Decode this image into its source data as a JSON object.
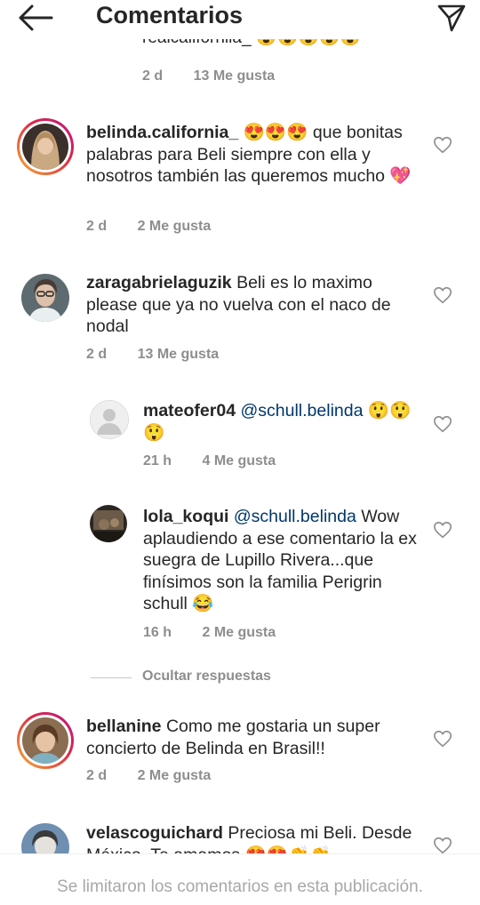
{
  "header": {
    "title": "Comentarios",
    "back_icon": "arrow-left-icon",
    "share_icon": "paper-plane-icon"
  },
  "top_partial": {
    "clipped_text": "realcaliforniia_ 😍😍😍😍😍",
    "time": "2 d",
    "likes": "13 Me gusta"
  },
  "comments": [
    {
      "username": "belinda.california_",
      "text": " 😍😍😍 que bonitas palabras para Beli siempre con ella y nosotros también las queremos mucho 💖",
      "time": "2 d",
      "likes": "2 Me gusta",
      "story_ring": true
    },
    {
      "username": "zaragabrielaguzik",
      "text": " Beli es lo maximo please que ya no vuelva con el naco de nodal",
      "time": "2 d",
      "likes": "13 Me gusta"
    }
  ],
  "replies": [
    {
      "username": "mateofer04",
      "mention": "@schull.belinda",
      "text": " 😲😲😲",
      "time": "21 h",
      "likes": "4 Me gusta"
    },
    {
      "username": "lola_koqui",
      "mention": "@schull.belinda",
      "text": " Wow aplaudiendo a ese comentario la ex suegra de Lupillo Rivera...que finísimos son la familia Perigrin schull 😂",
      "time": "16 h",
      "likes": "2 Me gusta"
    }
  ],
  "hide_replies_label": "Ocultar respuestas",
  "comments_after": [
    {
      "username": "bellanine",
      "text": " Como me gostaria un super concierto de Belinda en Brasil!!",
      "time": "2 d",
      "likes": "2 Me gusta",
      "story_ring": true
    },
    {
      "username": "velascoguichard",
      "text": " Preciosa mi Beli. Desde México. Te amamos 😍😍👏👏",
      "time": "",
      "likes": ""
    }
  ],
  "footer": {
    "text": "Se limitaron los comentarios en esta publicación."
  },
  "colors": {
    "text": "#262626",
    "muted": "#8e8e8e",
    "mention": "#00376b",
    "footer_text": "#a8a8a8"
  }
}
